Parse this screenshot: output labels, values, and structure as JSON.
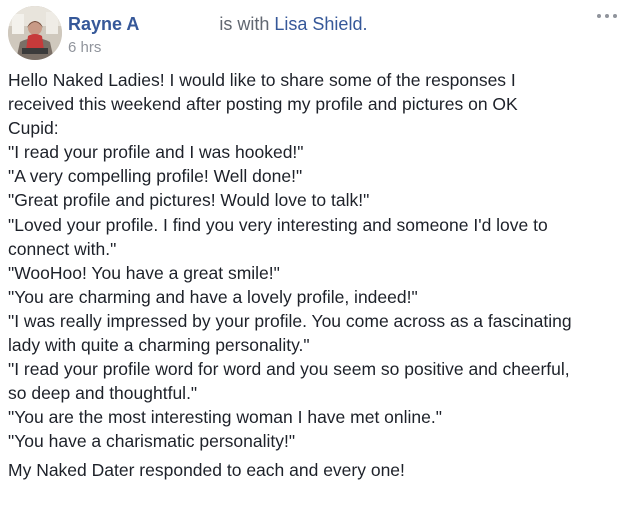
{
  "post": {
    "author": "Rayne A",
    "with_text": "is with",
    "tagged_name": "Lisa Shield.",
    "timestamp": "6 hrs",
    "icons": {
      "avatar": "profile-photo",
      "more": "more-options-icon"
    },
    "colors": {
      "link": "#365899",
      "meta": "#90949c",
      "text": "#1d2129"
    },
    "body_lines": [
      "Hello Naked Ladies! I would like to share some of the responses I",
      "received this weekend after posting my profile and pictures on OK",
      "Cupid:",
      "\"I read your profile and I was hooked!\"",
      "\"A very compelling profile! Well done!\"",
      "\"Great profile and pictures! Would love to talk!\"",
      "\"Loved your profile. I find you very interesting and someone I'd love to",
      "connect with.\"",
      "\"WooHoo! You have a great smile!\"",
      "\"You are charming and have a lovely profile, indeed!\"",
      "\"I was really impressed by your profile. You come across as a fascinating",
      "lady with quite a charming personality.\"",
      "\"I read your profile word for word and you seem so positive and cheerful,",
      "so deep and thoughtful.\"",
      "\"You are the most interesting woman I have met online.\"",
      "\"You have a charismatic personality!\""
    ],
    "closing_line": "My Naked Dater responded to each and every one!"
  }
}
